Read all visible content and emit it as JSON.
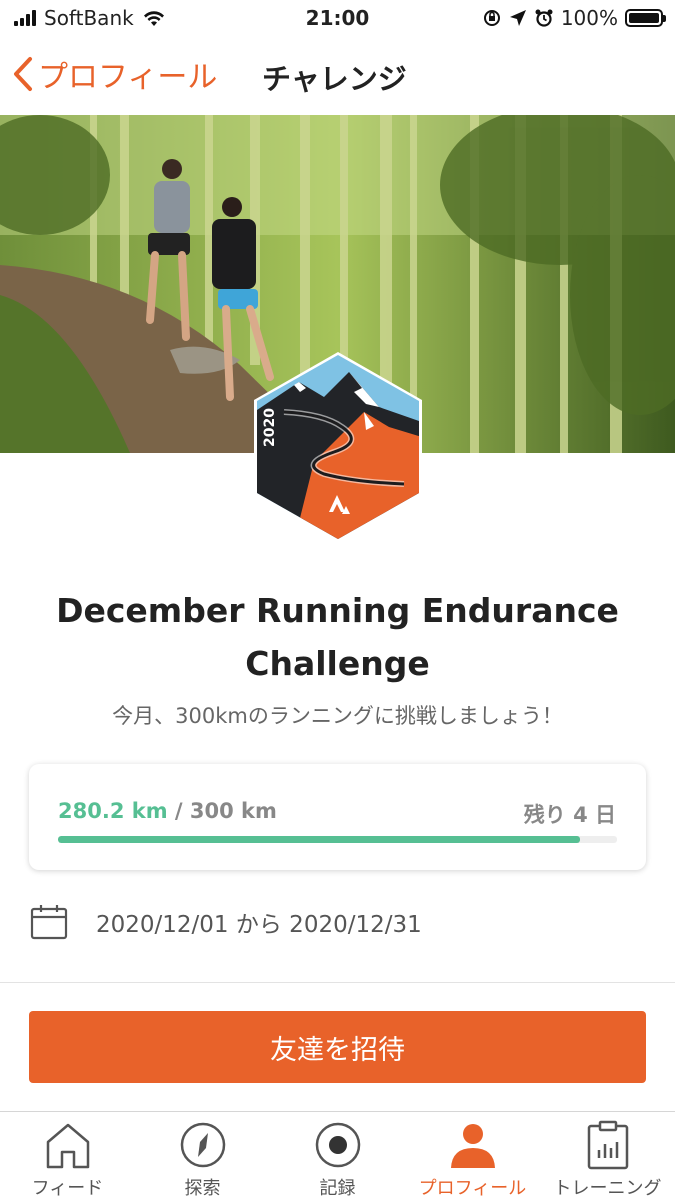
{
  "status_bar": {
    "carrier": "SoftBank",
    "time": "21:00",
    "battery": "100%"
  },
  "nav": {
    "back_label": "プロフィール",
    "title": "チャレンジ"
  },
  "badge": {
    "year": "2020"
  },
  "challenge": {
    "title": "December Running Endurance Challenge",
    "subtitle": "今月、300kmのランニングに挑戦しましょう！",
    "progress_current": "280.2 km",
    "progress_separator": " / ",
    "progress_total": "300 km",
    "progress_fraction": 0.934,
    "remaining": "残り 4 日",
    "dates": "2020/12/01 から 2020/12/31"
  },
  "invite_label": "友達を招待",
  "tabs": [
    {
      "label": "フィード",
      "icon": "home-icon"
    },
    {
      "label": "探索",
      "icon": "compass-icon"
    },
    {
      "label": "記録",
      "icon": "record-icon"
    },
    {
      "label": "プロフィール",
      "icon": "person-icon",
      "active": true
    },
    {
      "label": "トレーニング",
      "icon": "clipboard-chart-icon"
    }
  ],
  "colors": {
    "accent": "#e8622a",
    "progress": "#56bf93"
  }
}
